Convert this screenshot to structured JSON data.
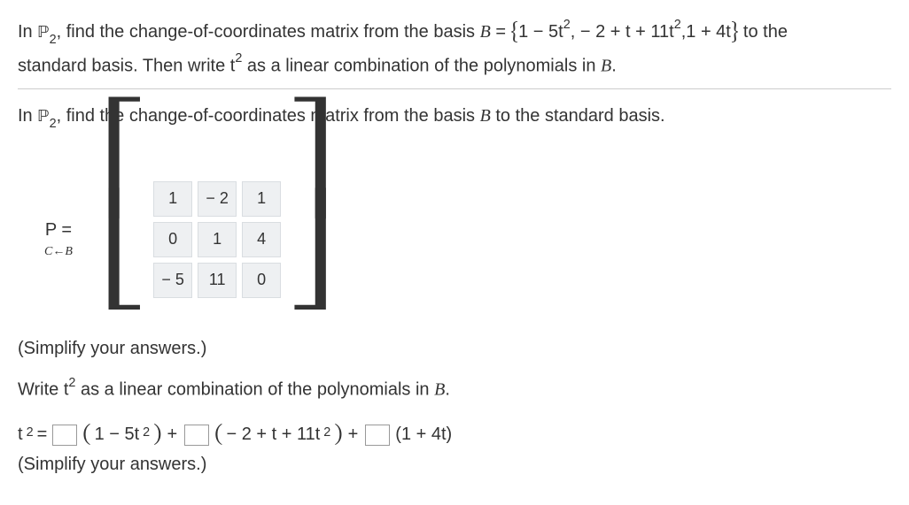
{
  "problem": {
    "line1_pre": "In ",
    "p2_sym": "ℙ",
    "p2_sub": "2",
    "line1_mid": ", find the change-of-coordinates matrix from the basis ",
    "B_label": "B",
    "eq": " = ",
    "set_open": "{",
    "b1_a": "1 − 5t",
    "sq": "2",
    "b1_b": ", − 2 + t + 11t",
    "b1_c": ",1 + 4t",
    "set_close": "}",
    "line1_end": " to the",
    "line2_a": "standard basis. Then write t",
    "line2_b": " as a linear combination of the polynomials in ",
    "line2_end": "."
  },
  "subq1": {
    "pre": "In ",
    "mid": ", find the change-of-coordinates matrix from the basis ",
    "end": " to the standard basis."
  },
  "matrix": {
    "lhs_p": "P",
    "lhs_eq": "  =",
    "lhs_sub": "C←B",
    "cells": [
      "1",
      "− 2",
      "1",
      "0",
      "1",
      "4",
      "− 5",
      "11",
      "0"
    ]
  },
  "hint": "(Simplify your answers.)",
  "subq2": {
    "pre": "Write t",
    "post": " as a linear combination of the polynomials in ",
    "end": "."
  },
  "eqline": {
    "t2_a": "t",
    "eq": " = ",
    "p1_open": "(",
    "p1_a": "1 − 5t",
    "p1_close": ")",
    "plus": " + ",
    "p2_a": " − 2 + t + 11t",
    "p3_a": "(1 + 4t)"
  }
}
